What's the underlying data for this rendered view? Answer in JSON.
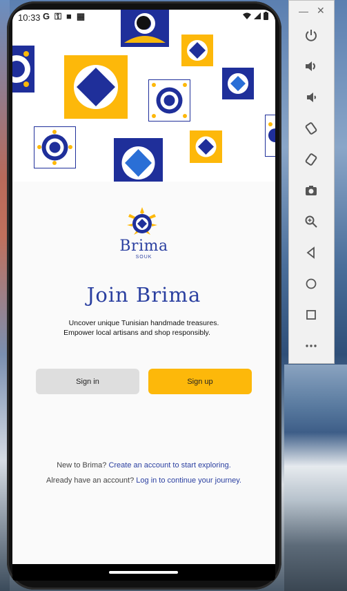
{
  "status_bar": {
    "time": "10:33",
    "left_icons": [
      "google-icon",
      "key-icon",
      "sdcard-icon",
      "layout-icon"
    ],
    "right_icons": [
      "wifi-icon",
      "signal-icon",
      "battery-icon"
    ]
  },
  "brand": {
    "name": "Brima",
    "subtitle": "SOUK"
  },
  "main": {
    "title": "Join Brima",
    "tagline_line1": "Uncover unique Tunisian handmade treasures.",
    "tagline_line2": "Empower local artisans and shop responsibly."
  },
  "buttons": {
    "signin_label": "Sign in",
    "signup_label": "Sign up"
  },
  "footer": {
    "line1_prefix": "New to Brima?",
    "line1_link": "Create an account to start exploring.",
    "line2_prefix": "Already have an account?",
    "line2_link": "Log in to continue your journey."
  },
  "colors": {
    "brand_blue": "#2a3fa0",
    "accent_yellow": "#fdb80a",
    "signin_gray": "#dedede"
  },
  "emulator_panel": {
    "window_controls": [
      "minimize-icon",
      "close-icon"
    ],
    "tools": [
      "power-icon",
      "volume-up-icon",
      "volume-down-icon",
      "rotate-left-icon",
      "rotate-right-icon",
      "camera-icon",
      "zoom-icon",
      "back-icon",
      "home-icon",
      "overview-icon",
      "more-icon"
    ]
  }
}
